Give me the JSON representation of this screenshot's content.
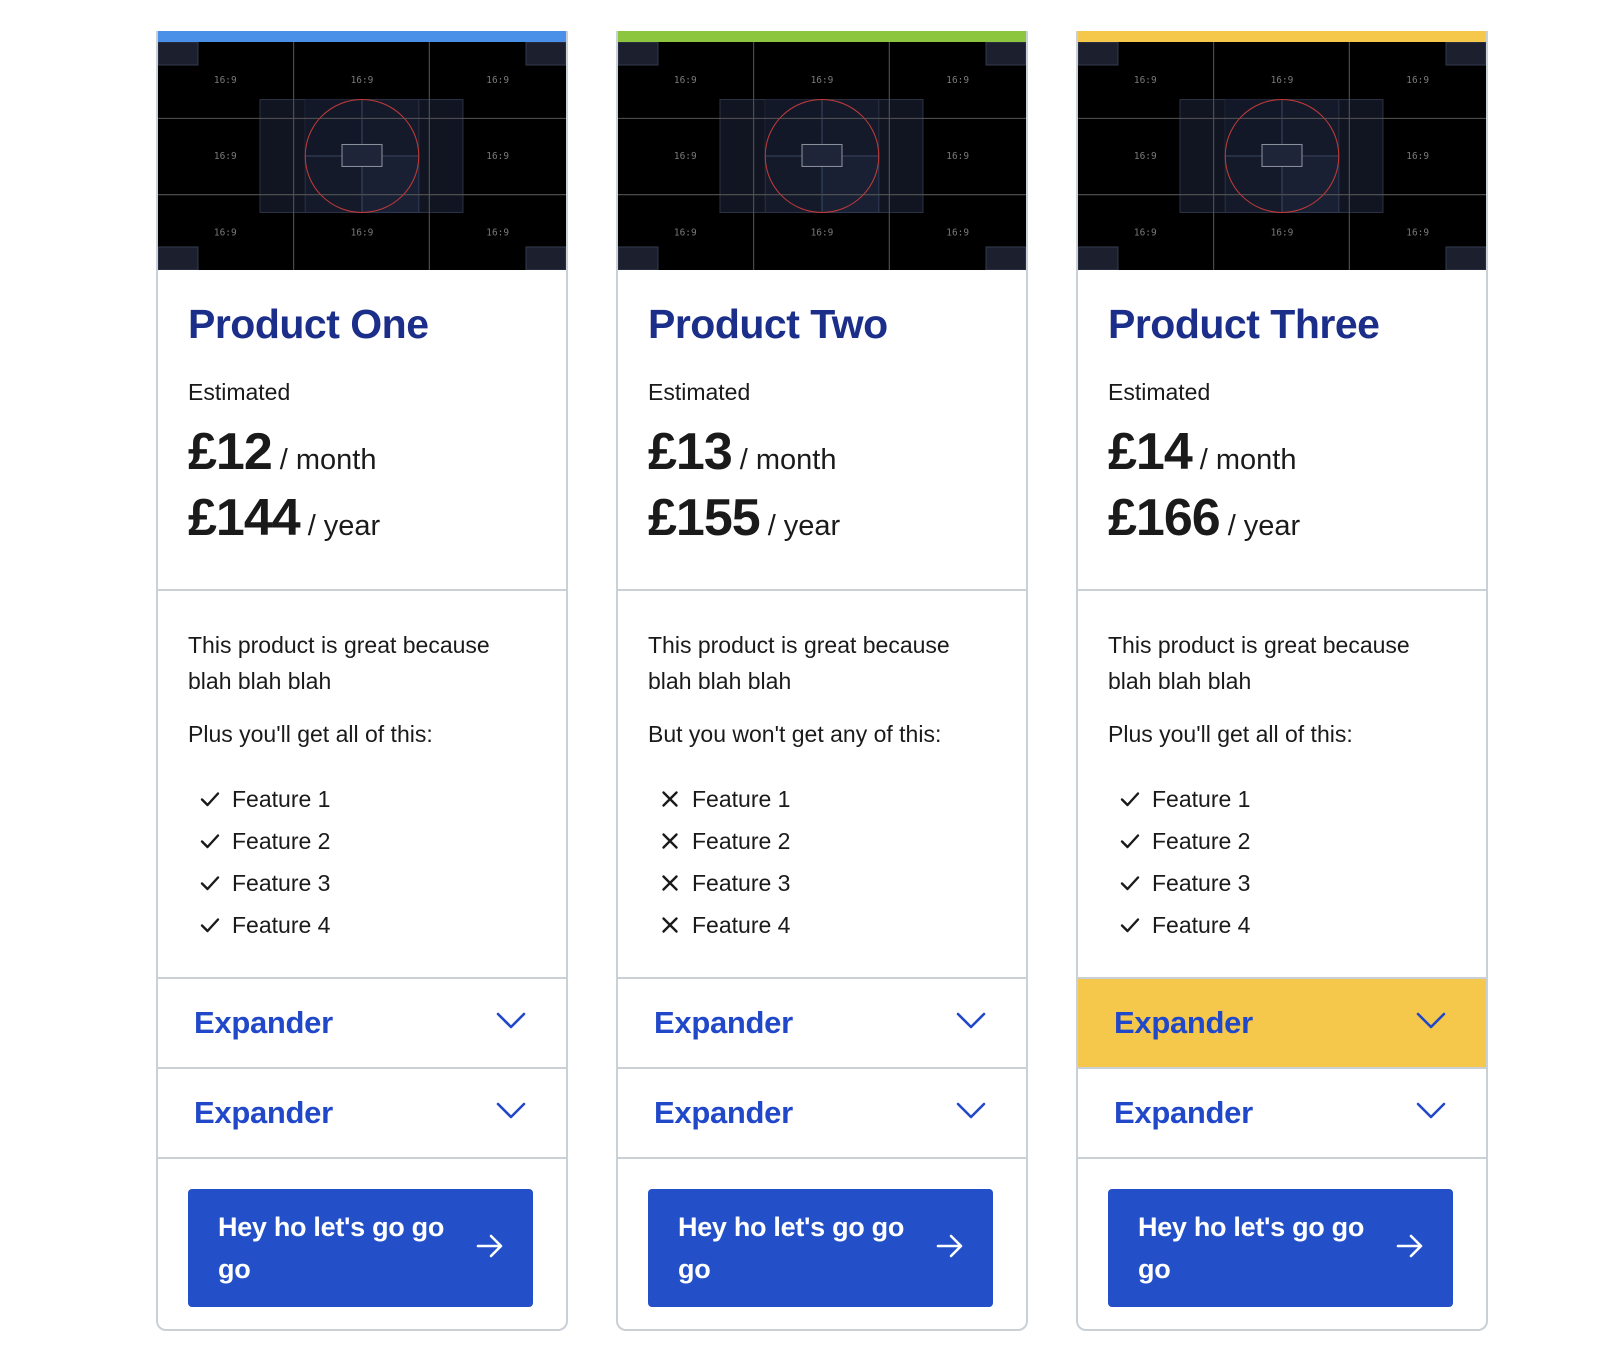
{
  "cards": [
    {
      "accent_color": "#4a90e8",
      "thumb_label": "16:9",
      "title": "Product One",
      "estimated": "Estimated",
      "monthly_price": "£12",
      "monthly_unit": "/ month",
      "yearly_price": "£144",
      "yearly_unit": "/ year",
      "desc": "This product is great because blah blah blah",
      "features_intro": "Plus you'll get all of this:",
      "feature_icon": "check-icon",
      "features": [
        "Feature 1",
        "Feature 2",
        "Feature 3",
        "Feature 4"
      ],
      "expanders": [
        {
          "label": "Expander",
          "highlighted": false
        },
        {
          "label": "Expander",
          "highlighted": false
        }
      ],
      "cta": "Hey ho let's go go go"
    },
    {
      "accent_color": "#8cc63f",
      "thumb_label": "16:9",
      "title": "Product Two",
      "estimated": "Estimated",
      "monthly_price": "£13",
      "monthly_unit": "/ month",
      "yearly_price": "£155",
      "yearly_unit": "/ year",
      "desc": "This product is great because blah blah blah",
      "features_intro": "But you won't get any of this:",
      "feature_icon": "cross-icon",
      "features": [
        "Feature 1",
        "Feature 2",
        "Feature 3",
        "Feature 4"
      ],
      "expanders": [
        {
          "label": "Expander",
          "highlighted": false
        },
        {
          "label": "Expander",
          "highlighted": false
        }
      ],
      "cta": "Hey ho let's go go go"
    },
    {
      "accent_color": "#f5c84c",
      "thumb_label": "16:9",
      "title": "Product Three",
      "estimated": "Estimated",
      "monthly_price": "£14",
      "monthly_unit": "/ month",
      "yearly_price": "£166",
      "yearly_unit": "/ year",
      "desc": "This product is great because blah blah blah",
      "features_intro": "Plus you'll get all of this:",
      "feature_icon": "check-icon",
      "features": [
        "Feature 1",
        "Feature 2",
        "Feature 3",
        "Feature 4"
      ],
      "expanders": [
        {
          "label": "Expander",
          "highlighted": true
        },
        {
          "label": "Expander",
          "highlighted": false
        }
      ],
      "cta": "Hey ho let's go go go"
    }
  ],
  "colors": {
    "title": "#1b2e8a",
    "link": "#2148c8",
    "button": "#2350c8",
    "highlight": "#f5c84c",
    "border": "#c9d0d6"
  }
}
